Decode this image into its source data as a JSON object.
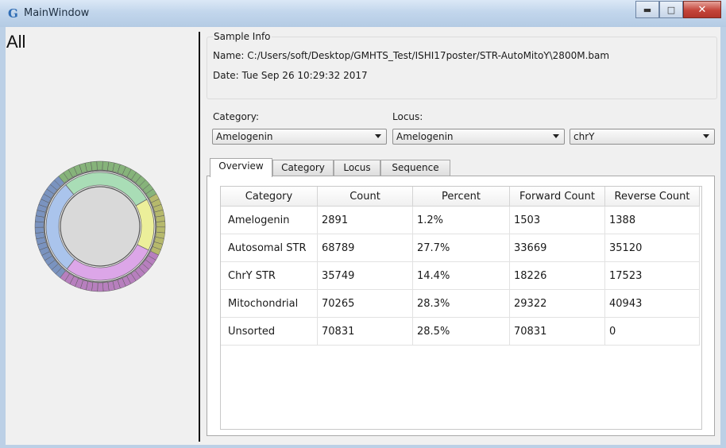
{
  "window": {
    "title": "MainWindow",
    "app_icon_glyph": "G",
    "controls": {
      "minimize": "minimize-icon",
      "maximize": "maximize-icon",
      "close": "close-icon"
    }
  },
  "left_panel": {
    "heading": "All",
    "sunburst": {
      "inner_colors": [
        "#a9ddb6",
        "#ecef9a",
        "#dca6e8",
        "#aac4ec"
      ],
      "outer_colors": [
        "#86b37a",
        "#b6b96c",
        "#b77fbe",
        "#7a93bf"
      ],
      "center_color": "#d9d9d9"
    }
  },
  "sample_info": {
    "group_title": "Sample Info",
    "name_label": "Name:",
    "name_value": "C:/Users/soft/Desktop/GMHTS_Test/ISHI17poster/STR-AutoMitoY\\2800M.bam",
    "date_label": "Date:",
    "date_value": "Tue Sep 26 10:29:32 2017"
  },
  "filters": {
    "category_label": "Category:",
    "category_value": "Amelogenin",
    "locus_label": "Locus:",
    "locus_value": "Amelogenin",
    "chrom_value": "chrY"
  },
  "tabs": [
    "Overview",
    "Category",
    "Locus",
    "Sequence"
  ],
  "active_tab": "Overview",
  "table": {
    "columns": [
      "Category",
      "Count",
      "Percent",
      "Forward Count",
      "Reverse Count"
    ],
    "rows": [
      [
        "Amelogenin",
        "2891",
        "1.2%",
        "1503",
        "1388"
      ],
      [
        "Autosomal STR",
        "68789",
        "27.7%",
        "33669",
        "35120"
      ],
      [
        "ChrY STR",
        "35749",
        "14.4%",
        "18226",
        "17523"
      ],
      [
        "Mitochondrial",
        "70265",
        "28.3%",
        "29322",
        "40943"
      ],
      [
        "Unsorted",
        "70831",
        "28.5%",
        "70831",
        "0"
      ]
    ]
  }
}
